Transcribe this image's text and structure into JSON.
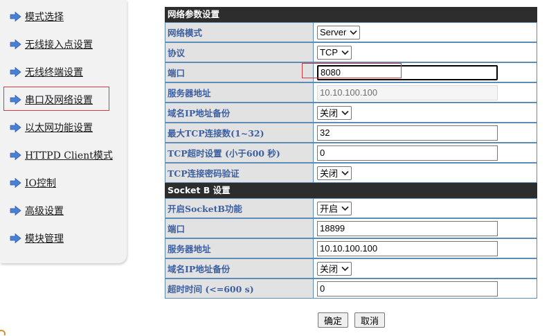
{
  "sidebar": {
    "items": [
      {
        "label": "模式选择"
      },
      {
        "label": "无线接入点设置"
      },
      {
        "label": "无线终端设置"
      },
      {
        "label": "串口及网络设置"
      },
      {
        "label": "以太网功能设置"
      },
      {
        "label": "HTTPD Client模式"
      },
      {
        "label": "IO控制"
      },
      {
        "label": "高级设置"
      },
      {
        "label": "模块管理"
      }
    ],
    "active_index": 3
  },
  "network": {
    "header": "网络参数设置",
    "rows": [
      {
        "label": "网络模式",
        "type": "select",
        "value": "Server"
      },
      {
        "label": "协议",
        "type": "select",
        "value": "TCP"
      },
      {
        "label": "端口",
        "type": "input",
        "value": "8080",
        "focused": true
      },
      {
        "label": "服务器地址",
        "type": "input",
        "value": "10.10.100.100",
        "disabled": true
      },
      {
        "label": "域名IP地址备份",
        "type": "select",
        "value": "关闭"
      },
      {
        "label": "最大TCP连接数(1~32)",
        "type": "input",
        "value": "32"
      },
      {
        "label": "TCP超时设置 (小于600 秒)",
        "type": "input",
        "value": "0"
      },
      {
        "label": "TCP连接密码验证",
        "type": "select",
        "value": "关闭"
      }
    ]
  },
  "socketb": {
    "header": "Socket B 设置",
    "rows": [
      {
        "label": "开启SocketB功能",
        "type": "select",
        "value": "开启"
      },
      {
        "label": "端口",
        "type": "input",
        "value": "18899"
      },
      {
        "label": "服务器地址",
        "type": "input",
        "value": "10.10.100.100"
      },
      {
        "label": "域名IP地址备份",
        "type": "select",
        "value": "关闭"
      },
      {
        "label": "超时时间 (<=600 s)",
        "type": "input",
        "value": "0"
      }
    ]
  },
  "actions": {
    "confirm_label": "确定",
    "cancel_label": "取消"
  },
  "colors": {
    "highlight": "#d9363e",
    "label_text": "#3b5fa0",
    "header_bg": "#2d2d2d"
  },
  "icons": {
    "nav": "arrow-right-icon",
    "corner": "app-glyph-icon"
  }
}
